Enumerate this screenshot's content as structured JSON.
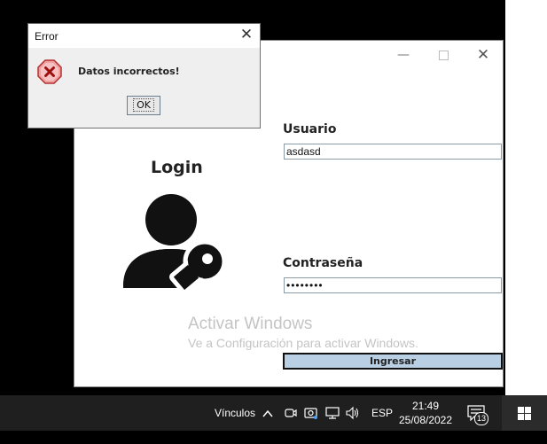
{
  "error_dialog": {
    "title": "Error",
    "close_glyph": "✕",
    "icon": "error-x-icon",
    "message": "Datos incorrectos!",
    "ok_label": "OK"
  },
  "app_window": {
    "minimize_glyph": "—",
    "close_glyph": "✕",
    "login_title": "Login",
    "icon": "user-key-icon",
    "user_label": "Usuario",
    "user_value": "asdasd",
    "password_label": "Contraseña",
    "password_value": "••••••••",
    "submit_label": "Ingresar",
    "submit_color": "#b8cfe4"
  },
  "watermark": {
    "line1": "Activar Windows",
    "line2": "Ve a Configuración para activar Windows."
  },
  "taskbar": {
    "links_label": "Vínculos",
    "chevron": "^",
    "tray_icons": [
      "meet-now-icon",
      "camera-icon",
      "network-icon",
      "volume-icon"
    ],
    "language": "ESP",
    "time": "21:49",
    "date": "25/08/2022",
    "notification_count": "13"
  }
}
